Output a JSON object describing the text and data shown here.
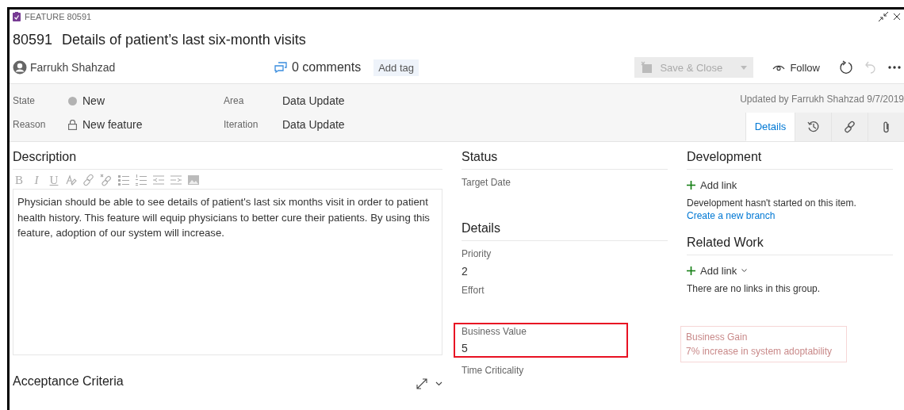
{
  "window": {
    "type_label": "FEATURE 80591"
  },
  "work_item": {
    "id": "80591",
    "title": "Details of patient’s last six-month visits"
  },
  "toolbar": {
    "assigned_to": "Farrukh Shahzad",
    "comments": "0 comments",
    "add_tag": "Add tag",
    "save_close": {
      "label": "Save & Close",
      "disabled": true
    },
    "follow": "Follow",
    "undo_disabled": true
  },
  "fields": [
    {
      "label": "State",
      "value": "New",
      "kind": "state"
    },
    {
      "label": "Area",
      "value": "Data Update",
      "kind": "plain"
    },
    {
      "label": "Reason",
      "value": "New feature",
      "kind": "locked"
    },
    {
      "label": "Iteration",
      "value": "Data Update",
      "kind": "plain"
    }
  ],
  "updated": "Updated by Farrukh Shahzad 9/7/2019",
  "tabs": [
    {
      "kind": "details",
      "label": "Details",
      "selected": true
    },
    {
      "kind": "history",
      "selected": false
    },
    {
      "kind": "links",
      "selected": false
    },
    {
      "kind": "attachments",
      "selected": false
    }
  ],
  "description": {
    "heading": "Description",
    "tools": [
      {
        "kind": "bold",
        "label": "B"
      },
      {
        "kind": "italic",
        "label": "I"
      },
      {
        "kind": "underline",
        "label": "U"
      },
      {
        "kind": "highlight"
      },
      {
        "kind": "link"
      },
      {
        "kind": "unlink"
      },
      {
        "kind": "bullets"
      },
      {
        "kind": "numbers"
      },
      {
        "kind": "outdent"
      },
      {
        "kind": "indent"
      },
      {
        "kind": "image"
      }
    ],
    "text": "Physician should be able to see details of patient's last six months visit in order to patient health history. This feature will equip physicians to better cure their patients. By using this feature, adoption of our system will increase."
  },
  "acceptance": {
    "heading": "Acceptance Criteria"
  },
  "status": {
    "heading": "Status",
    "fields": [
      {
        "label": "Target Date"
      }
    ]
  },
  "details": {
    "heading": "Details",
    "fields": [
      {
        "label": "Priority",
        "value": "2",
        "highlighted": false
      },
      {
        "label": "Effort",
        "highlighted": false
      },
      {
        "label": "Business Value",
        "value": "5",
        "highlighted": true
      },
      {
        "label": "Time Criticality",
        "highlighted": false
      }
    ]
  },
  "development": {
    "heading": "Development",
    "add_link": "Add link",
    "message": "Development hasn't started on this item.",
    "link": "Create a new branch"
  },
  "related_work": {
    "heading": "Related Work",
    "add_link": "Add link",
    "message": "There are no links in this group."
  },
  "ghost_card": {
    "title": "Business Gain",
    "text": "7% increase in system adoptability"
  }
}
